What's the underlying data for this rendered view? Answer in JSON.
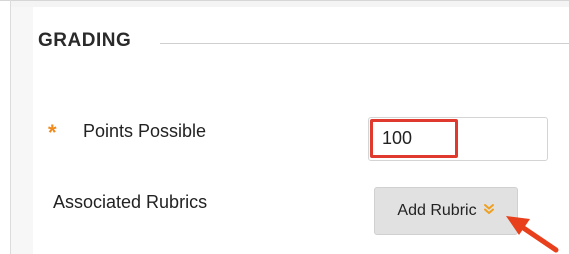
{
  "section": {
    "title": "GRADING"
  },
  "points_possible": {
    "required_marker": "*",
    "label": "Points Possible",
    "value": "100"
  },
  "associated_rubrics": {
    "label": "Associated Rubrics",
    "add_button_label": "Add Rubric",
    "add_button_icon": "double-chevron-down-icon"
  },
  "colors": {
    "required_star": "#f08a1d",
    "highlight_box": "#e03a2f",
    "callout_arrow": "#e8401c",
    "button_bg": "#e1e1e1",
    "chevron": "#f0a020"
  }
}
